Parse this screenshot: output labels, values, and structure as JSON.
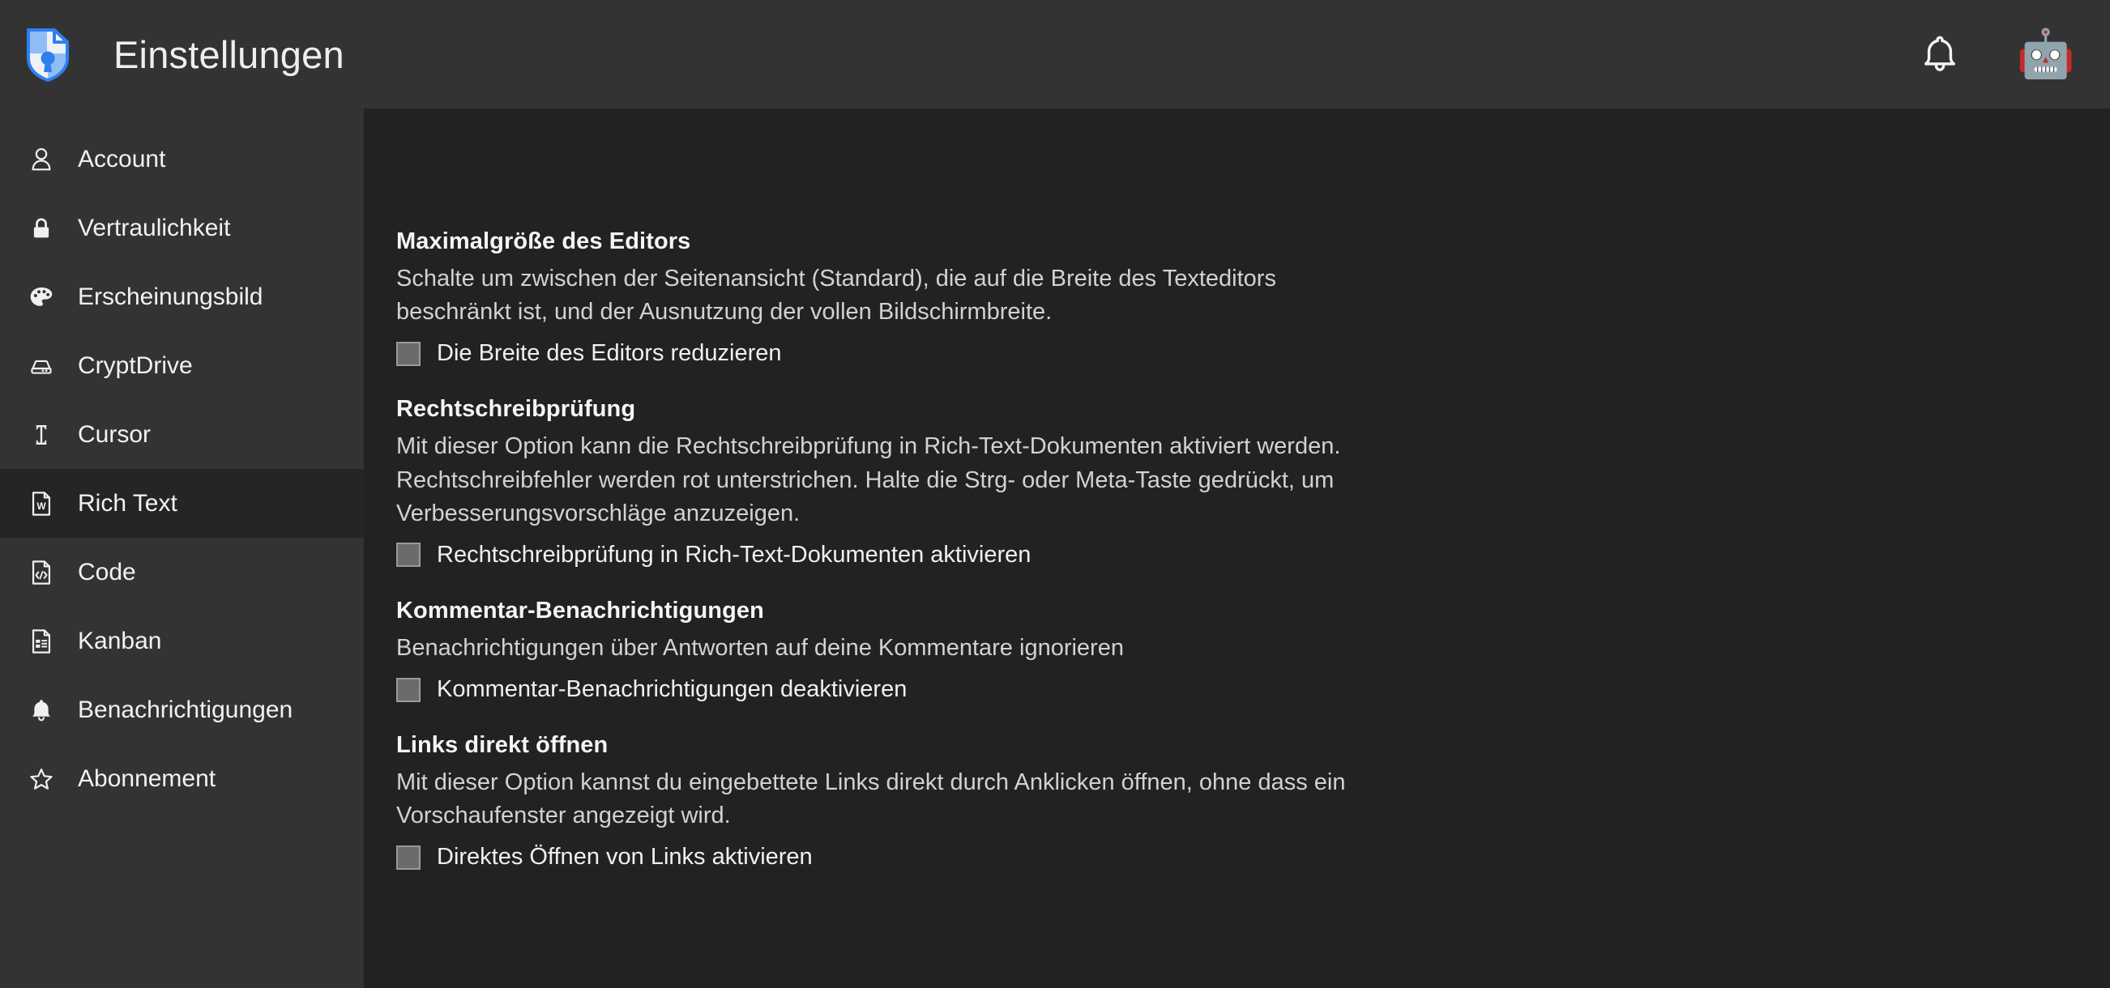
{
  "header": {
    "title": "Einstellungen",
    "logo_icon": "shield-document-lock-icon",
    "logo_colors": {
      "shield": "#2f80ed",
      "panel_light": "#8fbdf7",
      "panel_pale": "#eef2f6"
    },
    "notifications_icon": "bell-icon",
    "avatar_icon": "robot-avatar",
    "avatar_glyph": "🤖",
    "background": "#333333"
  },
  "sidebar": {
    "background": "#333333",
    "active_background": "#252525",
    "active_index": 5,
    "items": [
      {
        "label": "Account",
        "icon": "user-icon",
        "active": false
      },
      {
        "label": "Vertraulichkeit",
        "icon": "lock-icon",
        "active": false
      },
      {
        "label": "Erscheinungsbild",
        "icon": "palette-icon",
        "active": false
      },
      {
        "label": "CryptDrive",
        "icon": "hard-drive-icon",
        "active": false
      },
      {
        "label": "Cursor",
        "icon": "text-cursor-icon",
        "active": false
      },
      {
        "label": "Rich Text",
        "icon": "word-document-icon",
        "active": true
      },
      {
        "label": "Code",
        "icon": "code-document-icon",
        "active": false
      },
      {
        "label": "Kanban",
        "icon": "kanban-document-icon",
        "active": false
      },
      {
        "label": "Benachrichtigungen",
        "icon": "bell-icon",
        "active": false
      },
      {
        "label": "Abonnement",
        "icon": "star-icon",
        "active": false
      }
    ]
  },
  "main": {
    "background": "#222222",
    "sections": [
      {
        "title": "Maximalgröße des Editors",
        "description": "Schalte um zwischen der Seitenansicht (Standard), die auf die Breite des Texteditors beschränkt ist, und der Ausnutzung der vollen Bildschirmbreite.",
        "checkbox_label": "Die Breite des Editors reduzieren",
        "checked": false
      },
      {
        "title": "Rechtschreibprüfung",
        "description": "Mit dieser Option kann die Rechtschreibprüfung in Rich-Text-Dokumenten aktiviert werden. Rechtschreibfehler werden rot unterstrichen. Halte die Strg- oder Meta-Taste gedrückt, um Verbesserungsvorschläge anzuzeigen.",
        "checkbox_label": "Rechtschreibprüfung in Rich-Text-Dokumenten aktivieren",
        "checked": false
      },
      {
        "title": "Kommentar-Benachrichtigungen",
        "description": "Benachrichtigungen über Antworten auf deine Kommentare ignorieren",
        "checkbox_label": "Kommentar-Benachrichtigungen deaktivieren",
        "checked": false
      },
      {
        "title": "Links direkt öffnen",
        "description": "Mit dieser Option kannst du eingebettete Links direkt durch Anklicken öffnen, ohne dass ein Vorschaufenster angezeigt wird.",
        "checkbox_label": "Direktes Öffnen von Links aktivieren",
        "checked": false
      }
    ]
  }
}
